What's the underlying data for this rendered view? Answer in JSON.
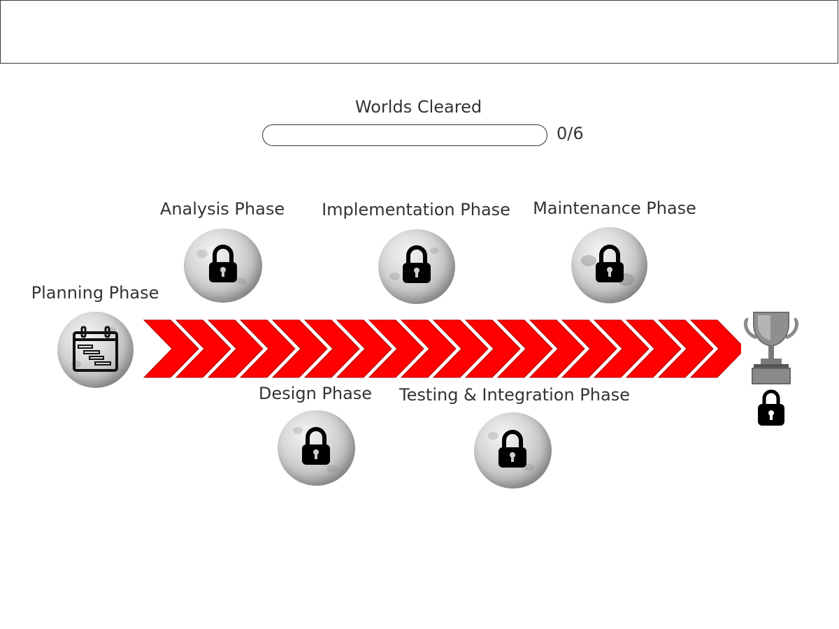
{
  "progress": {
    "title": "Worlds Cleared",
    "count": "0/6",
    "fraction": 0
  },
  "worlds": [
    {
      "label": "Planning Phase",
      "state": "unlocked",
      "icon": "calendar-gantt-icon"
    },
    {
      "label": "Analysis Phase",
      "state": "locked",
      "icon": "lock-icon"
    },
    {
      "label": "Design Phase",
      "state": "locked",
      "icon": "lock-icon"
    },
    {
      "label": "Implementation Phase",
      "state": "locked",
      "icon": "lock-icon"
    },
    {
      "label": "Testing & Integration Phase",
      "state": "locked",
      "icon": "lock-icon"
    },
    {
      "label": "Maintenance Phase",
      "state": "locked",
      "icon": "lock-icon"
    }
  ],
  "goal": {
    "icon": "trophy-icon",
    "state": "locked"
  },
  "colors": {
    "arrow": "#ff0000",
    "lock": "#000000",
    "trophy": "#8a8a8a"
  }
}
